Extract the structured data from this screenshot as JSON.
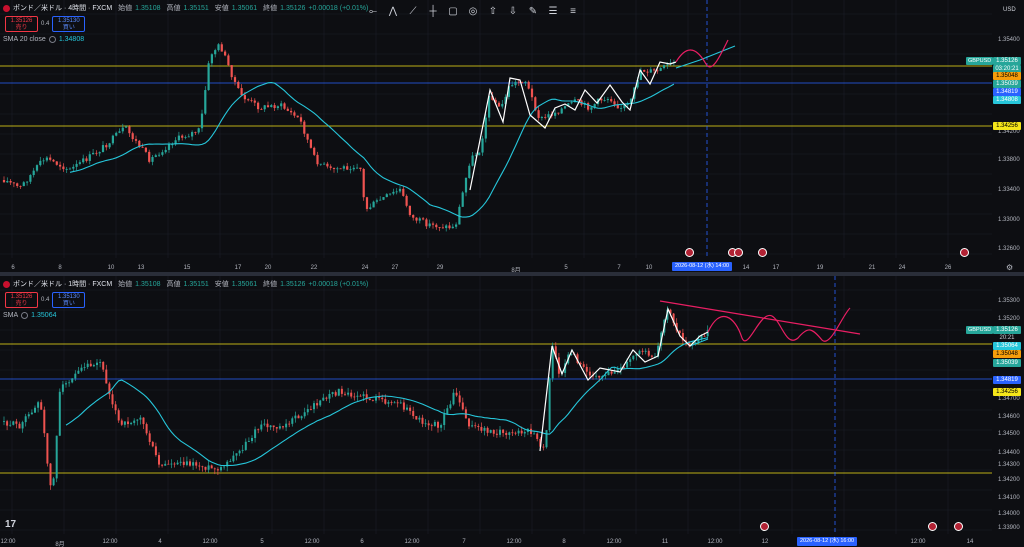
{
  "toolbar": {
    "tools": [
      "horizontal-ray-icon",
      "path-icon",
      "trendline-icon",
      "cross-line-icon",
      "rectangle-icon",
      "circle-icon",
      "arrow-up-icon",
      "arrow-down-icon",
      "brush-icon",
      "text-table-icon",
      "text-lines-icon"
    ]
  },
  "top_pane": {
    "title": "ポンド／米ドル · 4時間 · FXCM",
    "open_label": "始値",
    "open_value": "1.35108",
    "high_label": "高値",
    "high_value": "1.35151",
    "low_label": "安値",
    "low_value": "1.35061",
    "close_label": "終値",
    "close_value": "1.35126",
    "change": "+0.00018 (+0.01%)",
    "sell_price": "1.35126",
    "sell_label": "売り",
    "spread": "0.4",
    "buy_price": "1.35130",
    "buy_label": "買い",
    "sma_label": "SMA 20 close",
    "sma_value": "1.34808",
    "currency": "USD",
    "symbol_tag": "GBPUSD",
    "last_price": "1.35126",
    "countdown": "03:20:21",
    "price_labels": [
      {
        "text": "1.35048",
        "color": "#f59d0b"
      },
      {
        "text": "1.35039",
        "color": "#26a69a"
      },
      {
        "text": "1.34819",
        "color": "#2962ff"
      },
      {
        "text": "1.34808",
        "color": "#26c6da"
      },
      {
        "text": "1.34256",
        "color": "#f5e61a"
      }
    ],
    "y_ticks": [
      "1.35400",
      "1.35000",
      "1.34600",
      "1.34200",
      "1.33800",
      "1.33400",
      "1.33000",
      "1.32600"
    ],
    "x_ticks": [
      "6",
      "8",
      "10",
      "13",
      "15",
      "17",
      "20",
      "22",
      "24",
      "27",
      "29",
      "8月",
      "5",
      "7",
      "10",
      "14",
      "17",
      "19",
      "21",
      "24",
      "26"
    ],
    "cursor_time": "2026-08-12 (水)  14:00"
  },
  "bottom_pane": {
    "title": "ポンド／米ドル · 1時間 · FXCM",
    "open_label": "始値",
    "open_value": "1.35108",
    "high_label": "高値",
    "high_value": "1.35151",
    "low_label": "安値",
    "low_value": "1.35061",
    "close_label": "終値",
    "close_value": "1.35126",
    "change": "+0.00018 (+0.01%)",
    "sell_price": "1.35126",
    "sell_label": "売り",
    "spread": "0.4",
    "buy_price": "1.35130",
    "buy_label": "買い",
    "sma_label": "SMA",
    "sma_value": "1.35064",
    "symbol_tag": "GBPUSD",
    "last_price": "1.35126",
    "countdown": "20:21",
    "price_labels": [
      {
        "text": "1.35064",
        "color": "#26c6da"
      },
      {
        "text": "1.35048",
        "color": "#f59d0b"
      },
      {
        "text": "1.35039",
        "color": "#26a69a"
      },
      {
        "text": "1.34819",
        "color": "#2962ff"
      },
      {
        "text": "1.34256",
        "color": "#f5e61a"
      }
    ],
    "y_ticks": [
      "1.35300",
      "1.35200",
      "1.34700",
      "1.34600",
      "1.34500",
      "1.34400",
      "1.34300",
      "1.34200",
      "1.34100",
      "1.34000",
      "1.33900"
    ],
    "x_ticks": [
      "12:00",
      "8月",
      "12:00",
      "4",
      "12:00",
      "5",
      "12:00",
      "6",
      "12:00",
      "7",
      "12:00",
      "8",
      "12:00",
      "11",
      "12:00",
      "12",
      "12:00",
      "14"
    ],
    "cursor_time": "2026-08-12 (水)  16:00"
  },
  "colors": {
    "up": "#26a69a",
    "down": "#ef5350",
    "sma": "#26c6da",
    "projection": "#e91e63",
    "hline_yellow": "#f5e61a",
    "hline_blue": "#2962ff"
  }
}
